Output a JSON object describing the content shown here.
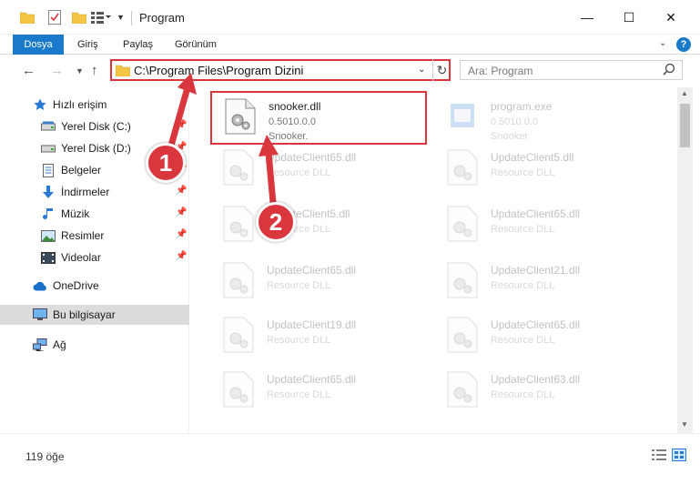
{
  "window": {
    "title": "Program",
    "minimize_glyph": "—",
    "maximize_glyph": "☐",
    "close_glyph": "✕"
  },
  "ribbon": {
    "tabs": [
      "Dosya",
      "Giriş",
      "Paylaş",
      "Görünüm"
    ],
    "help": "?"
  },
  "navigation": {
    "address": "C:\\Program Files\\Program Dizini",
    "search_placeholder": "Ara: Program"
  },
  "sidebar": {
    "items": [
      {
        "label": "Hızlı erişim",
        "icon": "star-icon"
      },
      {
        "label": "Yerel Disk (C:)",
        "icon": "drive-icon"
      },
      {
        "label": "Yerel Disk (D:)",
        "icon": "drive-icon"
      },
      {
        "label": "Belgeler",
        "icon": "documents-icon"
      },
      {
        "label": "İndirmeler",
        "icon": "download-icon"
      },
      {
        "label": "Müzik",
        "icon": "music-icon"
      },
      {
        "label": "Resimler",
        "icon": "pictures-icon"
      },
      {
        "label": "Videolar",
        "icon": "videos-icon"
      },
      {
        "label": "OneDrive",
        "icon": "cloud-icon"
      },
      {
        "label": "Bu bilgisayar",
        "icon": "computer-icon"
      },
      {
        "label": "Ağ",
        "icon": "network-icon"
      }
    ]
  },
  "files": [
    {
      "name": "snooker.dll",
      "line1": "0.5010.0.0",
      "line2": "Snooker."
    },
    {
      "name": "program.exe",
      "line1": "0.5010.0.0",
      "line2": "Snooker"
    },
    {
      "name": "UpdateClient65.dll",
      "line1": "Resource DLL",
      "line2": ""
    },
    {
      "name": "UpdateClient5.dll",
      "line1": "Resource DLL",
      "line2": ""
    },
    {
      "name": "UpdateClient5.dll",
      "line1": "Resource DLL",
      "line2": ""
    },
    {
      "name": "UpdateClient65.dll",
      "line1": "Resource DLL",
      "line2": ""
    },
    {
      "name": "UpdateClient65.dll",
      "line1": "Resource DLL",
      "line2": ""
    },
    {
      "name": "UpdateClient21.dll",
      "line1": "Resource DLL",
      "line2": ""
    },
    {
      "name": "UpdateClient19.dll",
      "line1": "Resource DLL",
      "line2": ""
    },
    {
      "name": "UpdateClient65.dll",
      "line1": "Resource DLL",
      "line2": ""
    },
    {
      "name": "UpdateClient65.dll",
      "line1": "Resource DLL",
      "line2": ""
    },
    {
      "name": "UpdateClient63.dll",
      "line1": "Resource DLL",
      "line2": ""
    }
  ],
  "status": {
    "count": "119 öğe"
  },
  "annotations": {
    "step1": "1",
    "step2": "2"
  },
  "colors": {
    "accent": "#1979ca",
    "highlight": "#d9363e"
  }
}
